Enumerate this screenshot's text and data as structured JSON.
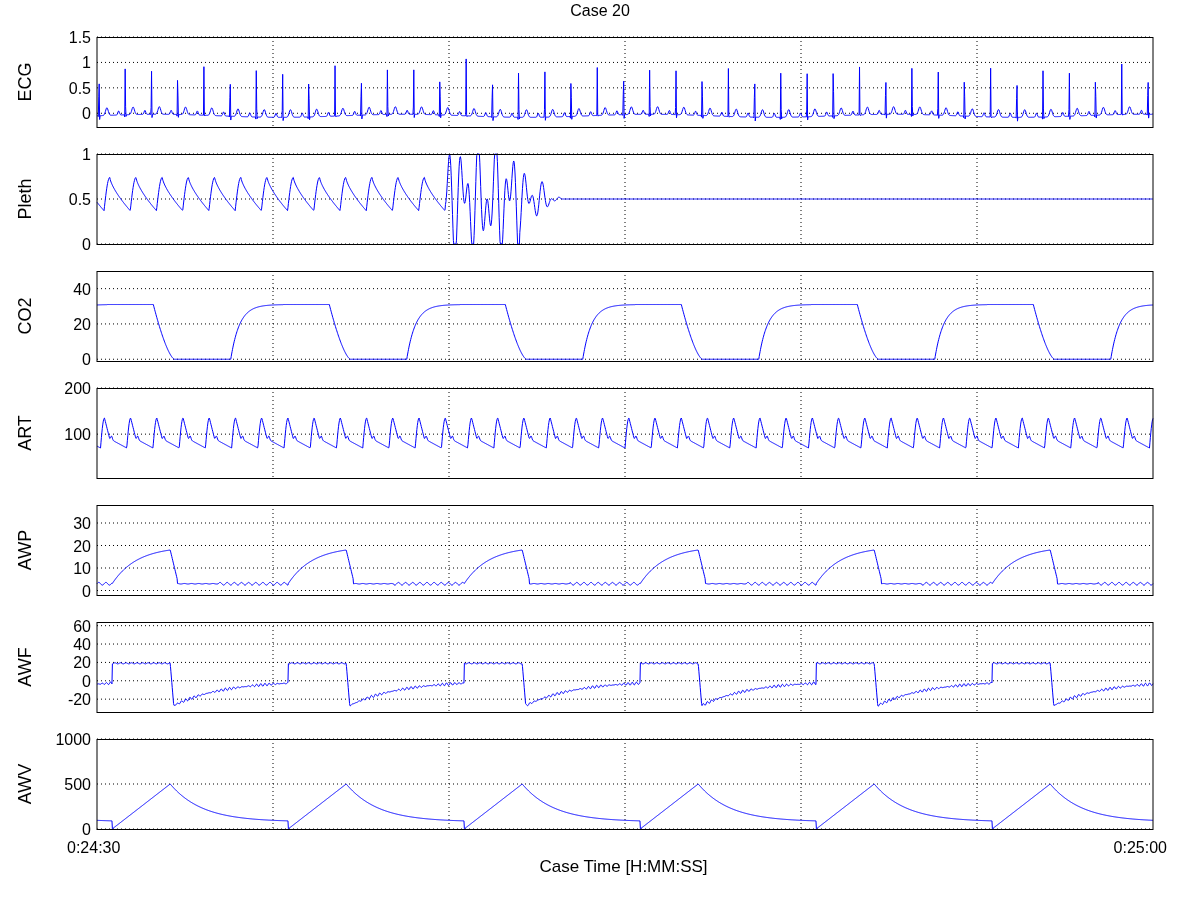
{
  "title": "Case 20",
  "panels": [
    {
      "kind": "ecg",
      "label": "ECG",
      "yticks": [
        "1.5",
        "1",
        "0.5",
        "0"
      ]
    },
    {
      "kind": "pleth",
      "label": "Pleth",
      "yticks": [
        "1",
        "0.5",
        "0"
      ]
    },
    {
      "kind": "co2",
      "label": "CO2",
      "yticks": [
        "40",
        "20",
        "0"
      ]
    },
    {
      "kind": "art",
      "label": "ART",
      "yticks": [
        "200",
        "100"
      ]
    },
    {
      "kind": "awp",
      "label": "AWP",
      "yticks": [
        "30",
        "20",
        "10",
        "0"
      ]
    },
    {
      "kind": "awf",
      "label": "AWF",
      "yticks": [
        "60",
        "40",
        "20",
        "0",
        "-20"
      ]
    },
    {
      "kind": "awv",
      "label": "AWV",
      "yticks": [
        "1000",
        "500",
        "0"
      ]
    }
  ],
  "time_axis": {
    "start": "0:24:30",
    "end": "0:25:00",
    "label": "Case Time [H:MM:SS]"
  }
}
